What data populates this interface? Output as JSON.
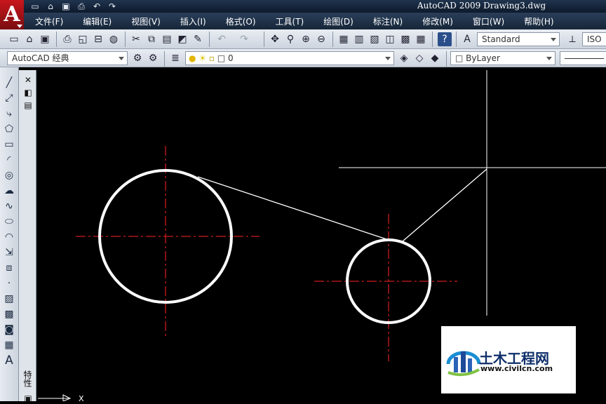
{
  "window": {
    "logo_letter": "A",
    "title": "AutoCAD 2009  Drawing3.dwg"
  },
  "quick_access": [
    "new-icon",
    "open-icon",
    "save-icon",
    "print-icon",
    "undo-icon",
    "redo-icon"
  ],
  "menu": [
    "文件(F)",
    "编辑(E)",
    "视图(V)",
    "插入(I)",
    "格式(O)",
    "工具(T)",
    "绘图(D)",
    "标注(N)",
    "修改(M)",
    "窗口(W)",
    "帮助(H)"
  ],
  "toolbar1": {
    "text_style": "Standard",
    "dim_style": "ISO"
  },
  "toolbar2": {
    "workspace": "AutoCAD 经典",
    "layer": "0",
    "color": "ByLayer"
  },
  "palette": {
    "label": "特性"
  },
  "drawing": {
    "ucs_x_label": "X",
    "line_color": "#ffffff",
    "centerline_color": "#cc1c1c"
  },
  "watermark": {
    "name": "土木工程网",
    "url": "www.civilcn.com"
  }
}
